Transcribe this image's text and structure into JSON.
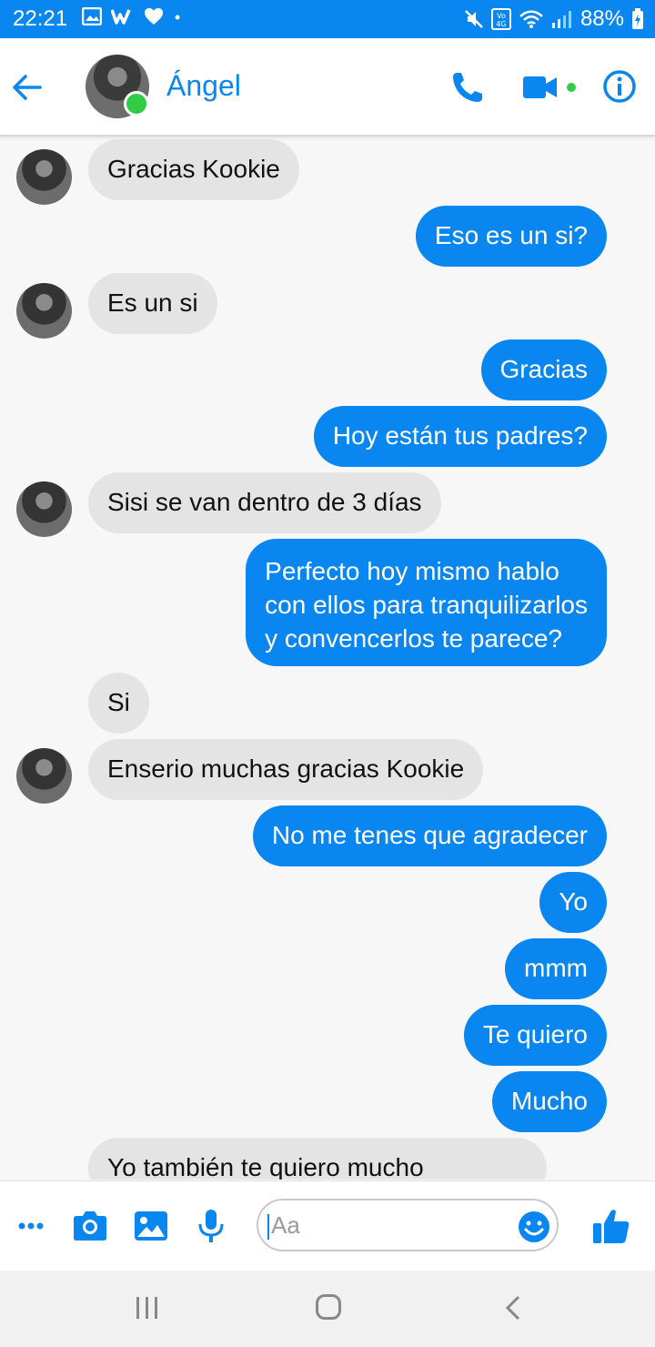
{
  "status_bar": {
    "time": "22:21",
    "battery": "88%",
    "network_label": "Vo 4G"
  },
  "header": {
    "contact_name": "Ángel"
  },
  "messages": [
    {
      "side": "in",
      "text": "Gracias Kookie",
      "avatar": true
    },
    {
      "side": "out",
      "text": "Eso es un si?"
    },
    {
      "side": "in",
      "text": "Es un si",
      "avatar": true
    },
    {
      "side": "out",
      "text": "Gracias"
    },
    {
      "side": "out",
      "text": "Hoy están tus padres?"
    },
    {
      "side": "in",
      "text": "Sisi se van dentro de 3 días",
      "avatar": true
    },
    {
      "side": "out",
      "lines": [
        "Perfecto hoy mismo hablo",
        "con ellos para tranquilizarlos",
        "y convencerlos te parece?"
      ]
    },
    {
      "side": "in",
      "text": "Si",
      "avatar": false
    },
    {
      "side": "in",
      "text": "Enserio muchas gracias Kookie",
      "avatar": true
    },
    {
      "side": "out",
      "text": "No me tenes que agradecer"
    },
    {
      "side": "out",
      "text": "Yo"
    },
    {
      "side": "out",
      "text": "mmm"
    },
    {
      "side": "out",
      "text": "Te quiero"
    },
    {
      "side": "out",
      "text": "Mucho"
    },
    {
      "side": "in",
      "text": "Yo también te quiero mucho",
      "avatar": false
    }
  ],
  "composer": {
    "placeholder": "Aa"
  },
  "colors": {
    "accent": "#0a86f0",
    "incoming_bubble": "#e4e4e4",
    "online": "#31cc46"
  }
}
